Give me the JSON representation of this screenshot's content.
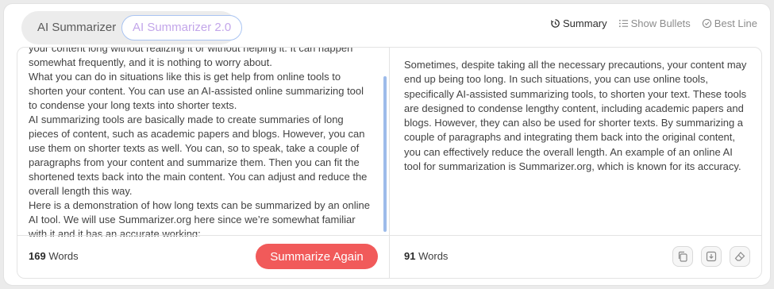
{
  "mode_tabs": [
    {
      "label": "AI Summarizer"
    },
    {
      "label": "AI Summarizer 2.0"
    }
  ],
  "view_tabs": [
    {
      "label": "Summary",
      "icon": "summary-icon",
      "active": true
    },
    {
      "label": "Show Bullets",
      "icon": "bullets-icon",
      "active": false
    },
    {
      "label": "Best Line",
      "icon": "best-line-icon",
      "active": false
    }
  ],
  "input": {
    "paragraphs": [
      "your content long without realizing it or without helping it. It can happen somewhat frequently, and it is nothing to worry about.",
      "What you can do in situations like this is get help from online tools to shorten your content. You can use an AI-assisted online summarizing tool to condense your long texts into shorter texts.",
      "AI summarizing tools are basically made to create summaries of long pieces of content, such as academic papers and blogs. However, you can use them on shorter texts as well. You can, so to speak, take a couple of paragraphs from your content and summarize them. Then you can fit the shortened texts back into the main content. You can adjust and reduce the overall length this way.",
      "Here is a demonstration of how long texts can be summarized by an online AI tool. We will use Summarizer.org here since we’re somewhat familiar with it and it has an accurate working:"
    ],
    "word_count": "169",
    "word_label": "Words",
    "summarize_label": "Summarize Again"
  },
  "output": {
    "text": "Sometimes, despite taking all the necessary precautions, your content may end up being too long. In such situations, you can use online tools, specifically AI-assisted summarizing tools, to shorten your text. These tools are designed to condense lengthy content, including academic papers and blogs. However, they can also be used for shorter texts. By summarizing a couple of paragraphs and integrating them back into the original content, you can effectively reduce the overall length. An example of an online AI tool for summarization is Summarizer.org, which is known for its accuracy.",
    "word_count": "91",
    "word_label": "Words",
    "actions": [
      "copy-icon",
      "download-icon",
      "eraser-icon"
    ]
  },
  "colors": {
    "accent_button": "#f15a5a",
    "tab_border": "#a9c4f2",
    "tab_text": "#c3a6ea",
    "scroll_thumb": "#9dbbea"
  }
}
